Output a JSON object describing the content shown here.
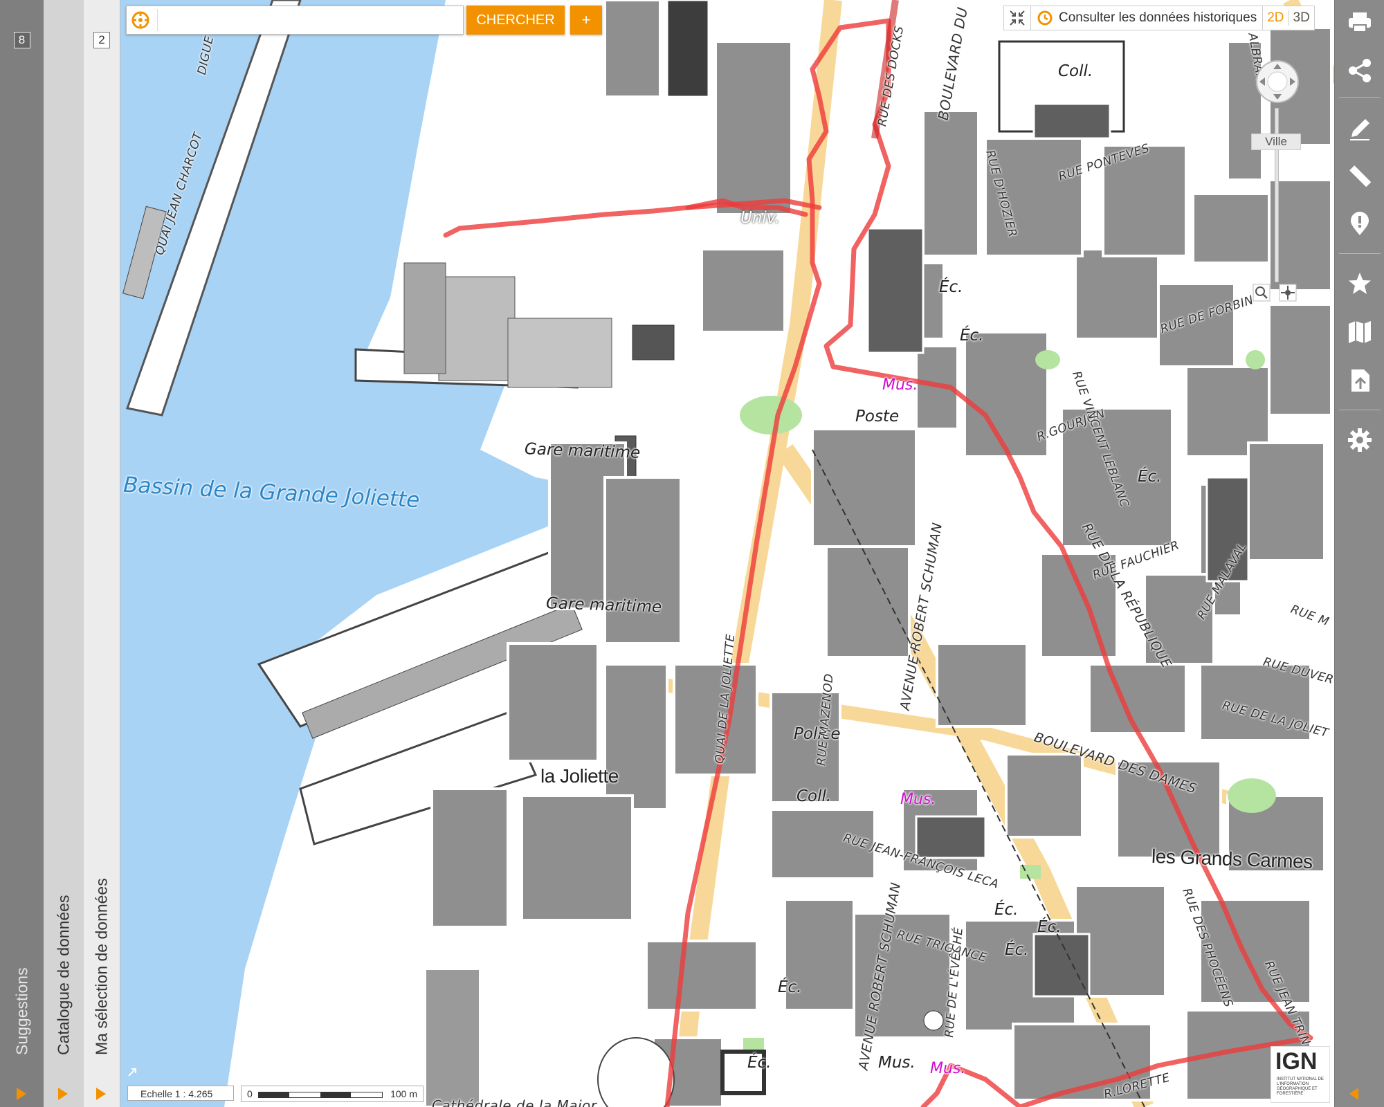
{
  "left_panels": {
    "suggestions": {
      "label": "Suggestions",
      "count": "8"
    },
    "catalogue": {
      "label": "Catalogue de données"
    },
    "selection": {
      "label": "Ma sélection de données",
      "count": "2"
    }
  },
  "search": {
    "placeholder": "",
    "value": "",
    "button_label": "CHERCHER",
    "plus_label": "+"
  },
  "toolbar": {
    "history_label": "Consulter les données historiques",
    "mode_2d": "2D",
    "mode_3d": "3D"
  },
  "zoom": {
    "level_label": "Ville"
  },
  "scale": {
    "ratio_label": "Echelle 1 :  4.265",
    "bar_start": "0",
    "bar_end": "100 m"
  },
  "logo": {
    "text": "IGN",
    "sub": "INSTITUT NATIONAL DE L'INFORMATION GÉOGRAPHIQUE ET FORESTIÈRE"
  },
  "map": {
    "water_label": "Bassin de la Grande Joliette",
    "places": [
      "la Joliette",
      "les Grands Carmes"
    ],
    "pois": [
      "Coll.",
      "Univ.",
      "Éc.",
      "Éc.",
      "Poste",
      "Gare maritime",
      "Gare maritime",
      "Police",
      "Coll.",
      "Éc.",
      "Éc.",
      "Éc.",
      "Éc.",
      "Éc.",
      "Éc.",
      "Mus."
    ],
    "museums": [
      "Mus.",
      "Mus.",
      "Mus."
    ],
    "streets": [
      "QUAI JEAN CHARCOT",
      "DIGUE",
      "RUE DES DOCKS",
      "BOULEVARD DU",
      "RUE PONTEVES",
      "RUE D'HOZIER",
      "RUE DE FORBIN",
      "R.GOURJON",
      "RUE VINCENT LEBLANC",
      "RUE DE LA RÉPUBLIQUE",
      "RUE FAUCHIER",
      "RUE MALAVAL",
      "AVENUE ROBERT SCHUMAN",
      "QUAI DE LA JOLIETTE",
      "RUE MAZENOD",
      "BOULEVARD DES DAMES",
      "RUE DE LA JOLIET",
      "RUE DUVER",
      "RUE JEAN-FRANÇOIS LECA",
      "RUE TRIGANCE",
      "RUE DES PHOCÉENS",
      "RUE DE L'ÉVÊCHÉ",
      "R.LORETTE",
      "RUE JEAN TRIN",
      "AVENUE ROBERT SCHUMAN",
      "RUE M",
      "ALBRAND",
      "Cathédrale de la Major"
    ]
  },
  "colors": {
    "accent": "#f39200",
    "water": "#a8d3f5",
    "route": "#ee3b3b",
    "road_major": "#f8d898",
    "building": "#8c8c8c"
  }
}
